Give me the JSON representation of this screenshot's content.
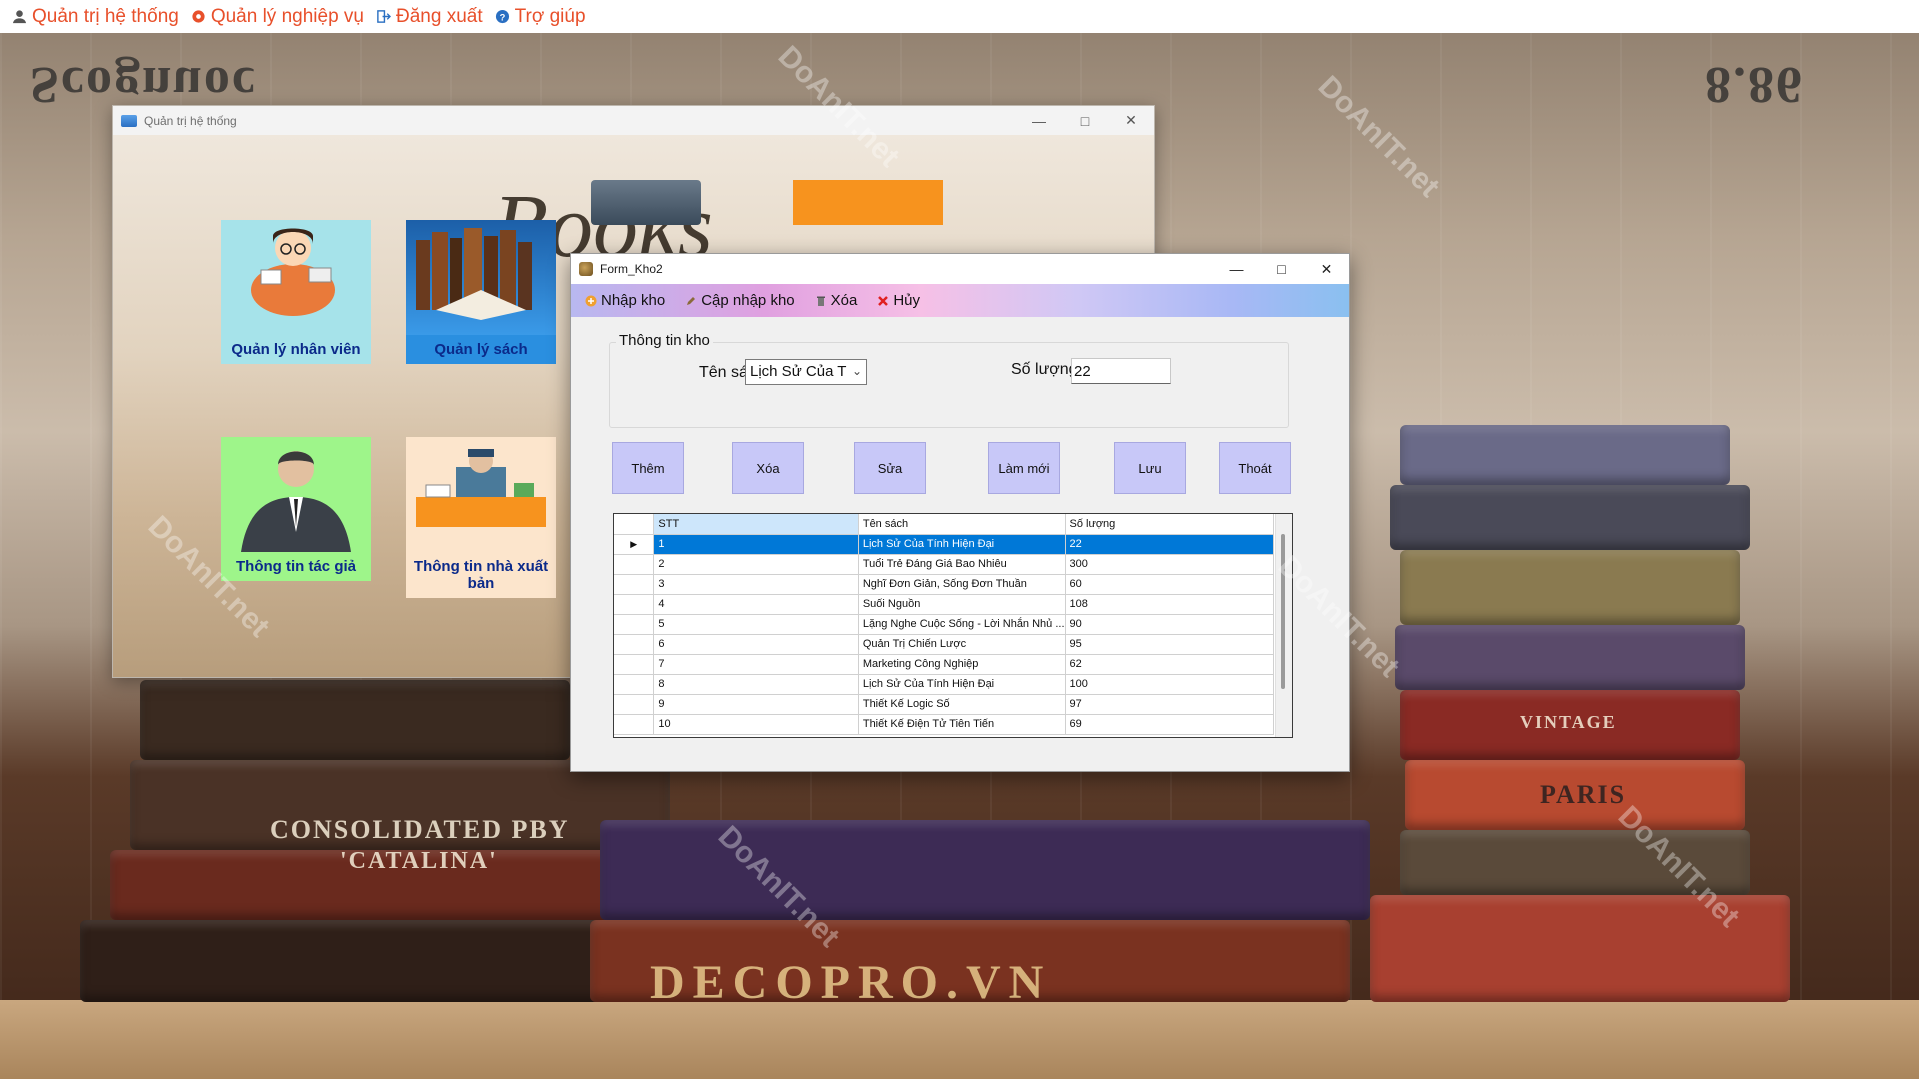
{
  "top_menu": {
    "items": [
      {
        "label": "Quản trị hệ thống",
        "icon": "user-icon"
      },
      {
        "label": "Quản lý nghiệp vụ",
        "icon": "gear-icon"
      },
      {
        "label": "Đăng xuất",
        "icon": "logout-icon"
      },
      {
        "label": "Trợ giúp",
        "icon": "help-icon"
      }
    ]
  },
  "background": {
    "stamp_1": "CONSOLIDATED PBY",
    "stamp_2": "'CATALINA'",
    "stamp_3": "DECOPRO.VN",
    "stamp_4": "VINTAGE",
    "stamp_5": "PARIS",
    "stamp_6": "8.86",
    "stamp_7": "Scognuoc"
  },
  "main_window": {
    "title": "Quản trị hệ thống",
    "books_text": "Books",
    "tiles": [
      {
        "label": "Quản lý nhân viên"
      },
      {
        "label": "Quản lý sách"
      },
      {
        "label": "Thông tin tác giả"
      },
      {
        "label": "Thông tin nhà xuất bản"
      }
    ]
  },
  "form_kho": {
    "title": "Form_Kho2",
    "menu": [
      {
        "label": "Nhập kho",
        "icon": "add-icon"
      },
      {
        "label": "Cập nhập kho",
        "icon": "edit-icon"
      },
      {
        "label": "Xóa",
        "icon": "trash-icon"
      },
      {
        "label": "Hủy",
        "icon": "x-icon"
      }
    ],
    "group_title": "Thông tin kho",
    "ten_sach_label": "Tên sách",
    "ten_sach_value": "Lịch Sử Của T",
    "so_luong_label": "Số lượng",
    "so_luong_value": "22",
    "buttons": {
      "them": "Thêm",
      "xoa": "Xóa",
      "sua": "Sửa",
      "lam_moi": "Làm mới",
      "luu": "Lưu",
      "thoat": "Thoát"
    },
    "grid": {
      "headers": [
        "STT",
        "Tên sách",
        "Số lượng"
      ],
      "rows": [
        [
          "1",
          "Lịch Sử Của Tính Hiện Đại",
          "22"
        ],
        [
          "2",
          "Tuổi Trẻ Đáng Giá Bao Nhiêu",
          "300"
        ],
        [
          "3",
          "Nghĩ Đơn Giản, Sống Đơn Thuần",
          "60"
        ],
        [
          "4",
          "Suối Nguồn",
          "108"
        ],
        [
          "5",
          "Lặng Nghe Cuộc Sống - Lời Nhắn Nhủ ...",
          "90"
        ],
        [
          "6",
          "Quản Trị Chiến Lược",
          "95"
        ],
        [
          "7",
          "Marketing Công Nghiệp",
          "62"
        ],
        [
          "8",
          "Lịch Sử Của Tính Hiện Đại",
          "100"
        ],
        [
          "9",
          "Thiết Kế Logic Số",
          "97"
        ],
        [
          "10",
          "Thiết Kế Điện Tử Tiên Tiến",
          "69"
        ]
      ]
    }
  },
  "watermark": "DoAnIT.net"
}
